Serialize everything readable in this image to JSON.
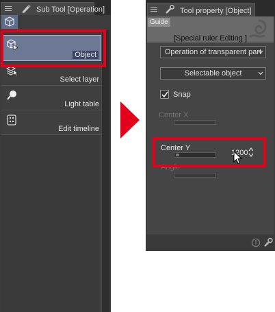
{
  "left_panel": {
    "title": "Sub Tool [Operation]",
    "tools": [
      {
        "label": "Object",
        "icon": "object-select-icon",
        "selected": true
      },
      {
        "label": "Select layer",
        "icon": "select-layer-icon",
        "selected": false
      },
      {
        "label": "Light table",
        "icon": "light-table-icon",
        "selected": false
      },
      {
        "label": "Edit timeline",
        "icon": "edit-timeline-icon",
        "selected": false
      }
    ]
  },
  "right_panel": {
    "title": "Tool property [Object]",
    "guide_label": "Guide",
    "guide_text": "[Special ruler Editing ]",
    "operation_dropdown": "Operation of transparent part",
    "selectable_dropdown": "Selectable object",
    "snap_label": "Snap",
    "snap_checked": true,
    "center_x_label": "Center X",
    "center_y_label": "Center Y",
    "center_y_value": "1200",
    "angle_label": "Angle"
  },
  "colors": {
    "highlight_red": "#e3001b",
    "selected_row": "#6d7895",
    "panel_bg": "#3c3c3c"
  }
}
